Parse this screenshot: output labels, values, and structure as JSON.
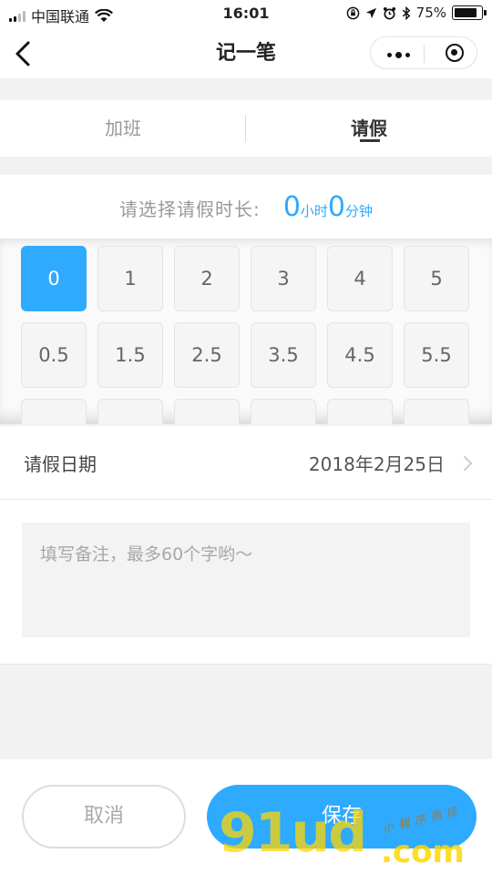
{
  "status_bar": {
    "carrier": "中国联通",
    "time": "16:01",
    "battery": "75%"
  },
  "nav": {
    "title": "记一笔"
  },
  "tabs": [
    {
      "label": "加班",
      "active": false
    },
    {
      "label": "请假",
      "active": true
    }
  ],
  "duration": {
    "label": "请选择请假时长:",
    "hours": "0",
    "hours_unit": "小时",
    "minutes": "0",
    "minutes_unit": "分钟"
  },
  "hour_options": {
    "row1": [
      "0",
      "1",
      "2",
      "3",
      "4",
      "5"
    ],
    "row2": [
      "0.5",
      "1.5",
      "2.5",
      "3.5",
      "4.5",
      "5.5"
    ],
    "selected": "0"
  },
  "date_row": {
    "label": "请假日期",
    "value": "2018年2月25日"
  },
  "note": {
    "placeholder": "填写备注，最多60个字哟～"
  },
  "buttons": {
    "cancel": "取消",
    "save": "保存"
  },
  "watermark": {
    "main": "91ud",
    "suffix": ".com",
    "small": "小程序商店"
  },
  "colors": {
    "accent": "#2eaaff",
    "watermark": "#ffd600"
  }
}
